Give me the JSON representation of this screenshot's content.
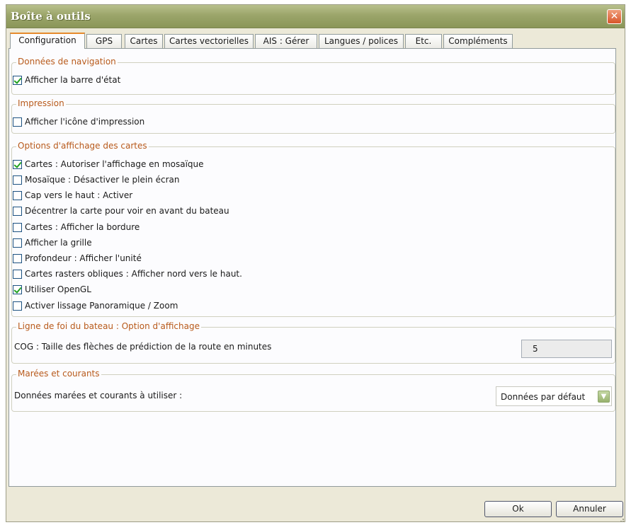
{
  "window": {
    "title": "Boîte à outils"
  },
  "tabs": [
    {
      "label": "Configuration",
      "active": true
    },
    {
      "label": "GPS"
    },
    {
      "label": "Cartes"
    },
    {
      "label": "Cartes vectorielles"
    },
    {
      "label": "AIS : Gérer"
    },
    {
      "label": "Langues / polices"
    },
    {
      "label": "Etc."
    },
    {
      "label": "Compléments"
    }
  ],
  "navigation": {
    "title": "Données de navigation",
    "items": [
      {
        "label": "Afficher la barre d'état",
        "checked": true
      }
    ]
  },
  "printing": {
    "title": "Impression",
    "items": [
      {
        "label": "Afficher l'icône d'impression",
        "checked": false
      }
    ]
  },
  "chart_display": {
    "title": "Options d'affichage des cartes",
    "items": [
      {
        "label": "Cartes : Autoriser l'affichage en mosaïque",
        "checked": true
      },
      {
        "label": "Mosaïque : Désactiver le plein écran",
        "checked": false
      },
      {
        "label": "Cap vers le haut : Activer",
        "checked": false
      },
      {
        "label": "Décentrer la carte pour voir en avant du bateau",
        "checked": false
      },
      {
        "label": "Cartes : Afficher la bordure",
        "checked": false
      },
      {
        "label": "Afficher la grille",
        "checked": false
      },
      {
        "label": "Profondeur : Afficher l'unité",
        "checked": false
      },
      {
        "label": "Cartes rasters obliques : Afficher nord vers le haut.",
        "checked": false
      },
      {
        "label": "Utiliser OpenGL",
        "checked": true
      },
      {
        "label": "Activer lissage Panoramique / Zoom",
        "checked": false
      }
    ]
  },
  "heading_line": {
    "title": "Ligne de foi du bateau : Option d'affichage",
    "cog_label": "COG : Taille des flèches de prédiction de la route en minutes",
    "cog_value": "5"
  },
  "tides": {
    "title": "Marées et courants",
    "label": "Données marées et courants  à utiliser :",
    "selected": "Données par défaut"
  },
  "buttons": {
    "ok": "Ok",
    "cancel": "Annuler"
  },
  "colors": {
    "titlebar": "#9ba56a",
    "group_title": "#b85a1b",
    "check": "#21a121",
    "close": "#d8552a",
    "active_tab_accent": "#e68b2c"
  }
}
